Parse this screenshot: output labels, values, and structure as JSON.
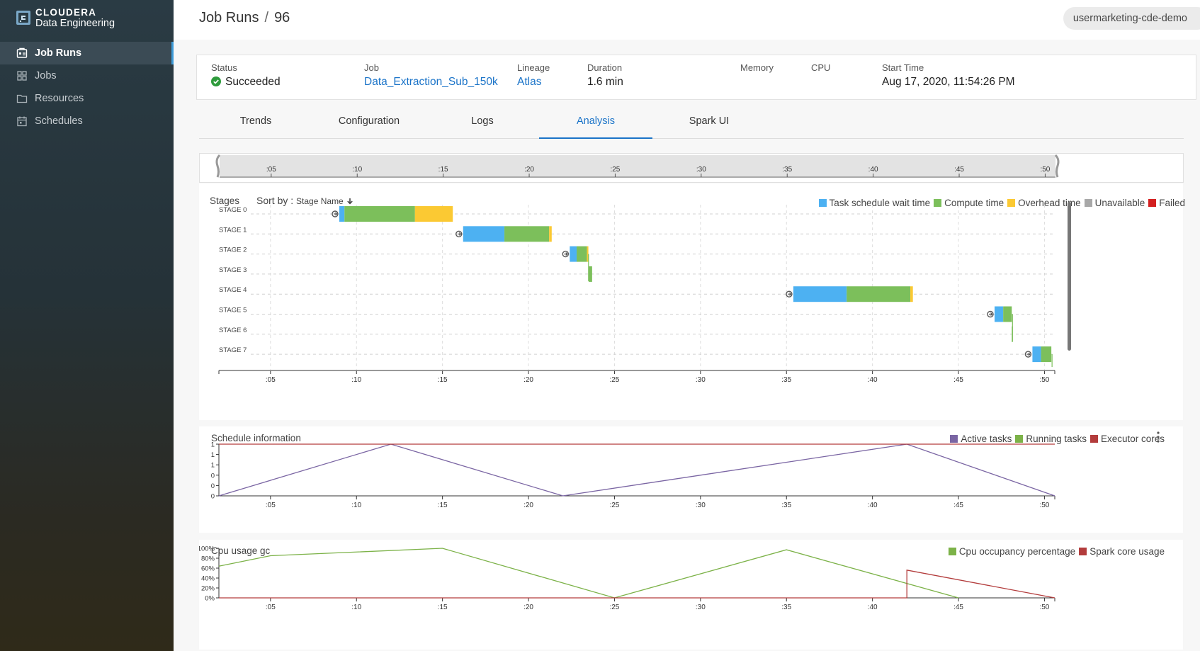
{
  "brand": {
    "line1": "CLOUDERA",
    "line2": "Data Engineering"
  },
  "sidebar": {
    "items": [
      {
        "label": "Job Runs",
        "icon": "job-runs-icon",
        "active": true
      },
      {
        "label": "Jobs",
        "icon": "grid-icon",
        "active": false
      },
      {
        "label": "Resources",
        "icon": "folder-icon",
        "active": false
      },
      {
        "label": "Schedules",
        "icon": "calendar-icon",
        "active": false
      }
    ]
  },
  "header": {
    "crumb_root": "Job Runs",
    "separator": "/",
    "crumb_id": "96",
    "virtual_cluster": "usermarketing-cde-demo"
  },
  "info": {
    "status_label": "Status",
    "status_value": "Succeeded",
    "job_label": "Job",
    "job_value": "Data_Extraction_Sub_150k",
    "lineage_label": "Lineage",
    "lineage_value": "Atlas",
    "duration_label": "Duration",
    "duration_value": "1.6 min",
    "memory_label": "Memory",
    "cpu_label": "CPU",
    "start_label": "Start Time",
    "start_value": "Aug 17, 2020, 11:54:26 PM"
  },
  "tabs": [
    "Trends",
    "Configuration",
    "Logs",
    "Analysis",
    "Spark UI"
  ],
  "active_tab": "Analysis",
  "time_ticks": [
    ":05",
    ":10",
    ":15",
    ":20",
    ":25",
    ":30",
    ":35",
    ":40",
    ":45",
    ":50"
  ],
  "stages_panel": {
    "title": "Stages",
    "sort_label": "Sort by :",
    "sort_value": "Stage Name",
    "legend": [
      {
        "label": "Task schedule wait time",
        "color": "#4db1f2"
      },
      {
        "label": "Compute time",
        "color": "#7cbf5b"
      },
      {
        "label": "Overhead time",
        "color": "#fbc933"
      },
      {
        "label": "Unavailable",
        "color": "#a8a8a8"
      },
      {
        "label": "Failed",
        "color": "#d32020"
      }
    ]
  },
  "schedule_panel": {
    "title": "Schedule information",
    "legend": [
      {
        "label": "Active tasks",
        "color": "#7a65a3"
      },
      {
        "label": "Running tasks",
        "color": "#7cb248"
      },
      {
        "label": "Executor cores",
        "color": "#b33c3c"
      }
    ],
    "y_ticks": [
      "1",
      "1",
      "1",
      "0",
      "0",
      "0"
    ]
  },
  "cpu_panel": {
    "title": "Cpu usage gc",
    "legend": [
      {
        "label": "Cpu occupancy percentage",
        "color": "#7cb248"
      },
      {
        "label": "Spark core usage",
        "color": "#b33c3c"
      }
    ],
    "y_ticks": [
      "100%",
      "80%",
      "60%",
      "40%",
      "20%",
      "0%"
    ]
  },
  "chart_data": [
    {
      "type": "bar",
      "title": "Stages",
      "x_unit": "seconds",
      "xlim": [
        2,
        50.6
      ],
      "categories": [
        "STAGE 0",
        "STAGE 1",
        "STAGE 2",
        "STAGE 3",
        "STAGE 4",
        "STAGE 5",
        "STAGE 6",
        "STAGE 7"
      ],
      "stages": [
        {
          "name": "STAGE 0",
          "start": 9.0,
          "wait": 0.3,
          "compute": 4.1,
          "overhead": 2.2
        },
        {
          "name": "STAGE 1",
          "start": 16.2,
          "wait": 2.4,
          "compute": 2.6,
          "overhead": 0.15
        },
        {
          "name": "STAGE 2",
          "start": 22.4,
          "wait": 0.4,
          "compute": 0.6,
          "overhead": 0.05
        },
        {
          "name": "STAGE 3",
          "start": 23.5,
          "wait": 0.0,
          "compute": 0.2,
          "overhead": 0.0
        },
        {
          "name": "STAGE 4",
          "start": 35.4,
          "wait": 3.1,
          "compute": 3.7,
          "overhead": 0.15
        },
        {
          "name": "STAGE 5",
          "start": 47.1,
          "wait": 0.5,
          "compute": 0.5,
          "overhead": 0.0
        },
        {
          "name": "STAGE 6",
          "start": 48.1,
          "wait": 0.0,
          "compute": 0.05,
          "overhead": 0.0
        },
        {
          "name": "STAGE 7",
          "start": 49.3,
          "wait": 0.5,
          "compute": 0.6,
          "overhead": 0.0
        }
      ]
    },
    {
      "type": "line",
      "title": "Schedule information",
      "xlim": [
        2,
        50.6
      ],
      "series": [
        {
          "name": "Active tasks",
          "x": [
            2,
            12,
            22,
            42,
            50.6
          ],
          "y": [
            0,
            1.5,
            0,
            1.5,
            0
          ]
        },
        {
          "name": "Executor cores",
          "x": [
            2,
            50.6
          ],
          "y": [
            1.5,
            1.5
          ]
        }
      ]
    },
    {
      "type": "line",
      "title": "Cpu usage gc",
      "xlim": [
        2,
        50.6
      ],
      "ylim": [
        0,
        100
      ],
      "series": [
        {
          "name": "Cpu occupancy percentage",
          "x": [
            2,
            5,
            15,
            25,
            35,
            45
          ],
          "y": [
            64,
            85,
            100,
            0,
            97,
            0
          ]
        },
        {
          "name": "Spark core usage",
          "x": [
            2,
            42,
            42,
            50.6
          ],
          "y": [
            0,
            0,
            56,
            0
          ]
        }
      ]
    }
  ]
}
